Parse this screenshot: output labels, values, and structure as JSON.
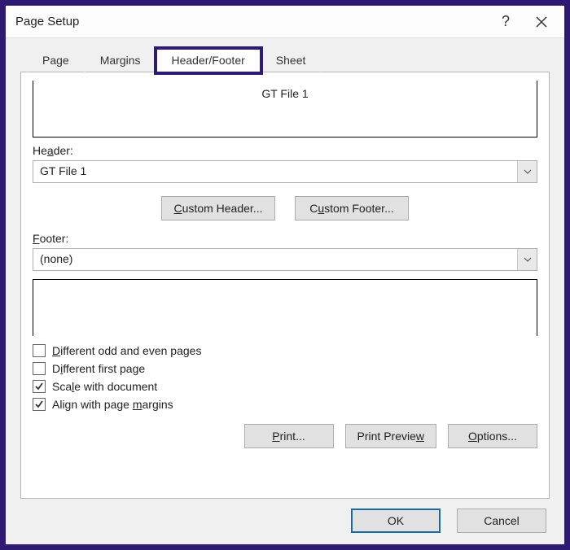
{
  "window": {
    "title": "Page Setup"
  },
  "tabs": {
    "page": "Page",
    "margins": "Margins",
    "header_footer": "Header/Footer",
    "sheet": "Sheet"
  },
  "header_preview": "GT File 1",
  "footer_preview": "",
  "labels": {
    "header_pre": "He",
    "header_ul": "a",
    "header_post": "der:",
    "footer_ul": "F",
    "footer_post": "ooter:"
  },
  "combos": {
    "header_value": "GT File 1",
    "footer_value": "(none)"
  },
  "buttons": {
    "custom_header_ul": "C",
    "custom_header_post": "ustom Header...",
    "custom_footer_pre": "C",
    "custom_footer_ul": "u",
    "custom_footer_post": "stom Footer...",
    "print_ul": "P",
    "print_post": "rint...",
    "preview_pre": "Print Previe",
    "preview_ul": "w",
    "options_ul": "O",
    "options_post": "ptions...",
    "ok": "OK",
    "cancel": "Cancel"
  },
  "checks": {
    "diff_odd_even_ul": "D",
    "diff_odd_even_post": "ifferent odd and even pages",
    "diff_odd_even_checked": false,
    "diff_first_pre": "D",
    "diff_first_ul": "i",
    "diff_first_post": "fferent first page",
    "diff_first_checked": false,
    "scale_pre": "Sca",
    "scale_ul": "l",
    "scale_post": "e with document",
    "scale_checked": true,
    "align_pre": "Align with page ",
    "align_ul": "m",
    "align_post": "argins",
    "align_checked": true
  }
}
